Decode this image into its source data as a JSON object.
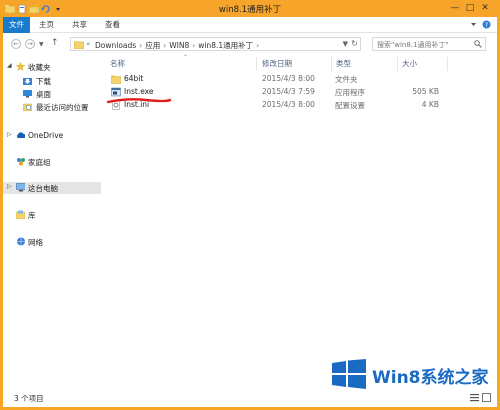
{
  "window": {
    "title": "win8.1通用补丁",
    "accent": "#f6a623"
  },
  "ribbon": {
    "tabs": [
      "文件",
      "主页",
      "共享",
      "查看"
    ]
  },
  "address": {
    "crumbs": [
      "Downloads",
      "应用",
      "WIN8",
      "win8.1通用补丁"
    ],
    "search_placeholder": "搜索\"win8.1通用补丁\""
  },
  "nav": {
    "favorites": "收藏夹",
    "downloads": "下载",
    "desktop": "桌面",
    "recent": "最近访问的位置",
    "onedrive": "OneDrive",
    "homegroup": "家庭组",
    "thispc": "这台电脑",
    "libraries": "库",
    "network": "网络"
  },
  "columns": {
    "name": "名称",
    "date": "修改日期",
    "type": "类型",
    "size": "大小"
  },
  "files": [
    {
      "name": "64bit",
      "date": "2015/4/3 8:00",
      "type": "文件夹",
      "size": "",
      "icon": "folder-icon"
    },
    {
      "name": "Inst.exe",
      "date": "2015/4/3 7:59",
      "type": "应用程序",
      "size": "505 KB",
      "icon": "exe-icon"
    },
    {
      "name": "Inst.ini",
      "date": "2015/4/3 8:00",
      "type": "配置设置",
      "size": "4 KB",
      "icon": "ini-icon"
    }
  ],
  "status": {
    "count": "3 个项目"
  },
  "watermark": {
    "text": "Win8系统之家"
  }
}
